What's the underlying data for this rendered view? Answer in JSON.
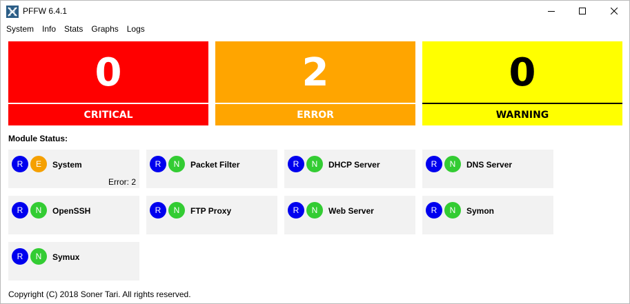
{
  "window": {
    "title": "PFFW 6.4.1"
  },
  "menu": [
    "System",
    "Info",
    "Stats",
    "Graphs",
    "Logs"
  ],
  "summary": {
    "critical": {
      "count": "0",
      "label": "CRITICAL",
      "color": "#ff0000"
    },
    "error": {
      "count": "2",
      "label": "ERROR",
      "color": "#ffa500"
    },
    "warning": {
      "count": "0",
      "label": "WARNING",
      "color": "#ffff00"
    }
  },
  "section_label": "Module Status:",
  "modules": [
    {
      "name": "System",
      "running": "R",
      "status": "E",
      "error_text": "Error: 2"
    },
    {
      "name": "Packet Filter",
      "running": "R",
      "status": "N"
    },
    {
      "name": "DHCP Server",
      "running": "R",
      "status": "N"
    },
    {
      "name": "DNS Server",
      "running": "R",
      "status": "N"
    },
    {
      "name": "OpenSSH",
      "running": "R",
      "status": "N"
    },
    {
      "name": "FTP Proxy",
      "running": "R",
      "status": "N"
    },
    {
      "name": "Web Server",
      "running": "R",
      "status": "N"
    },
    {
      "name": "Symon",
      "running": "R",
      "status": "N"
    },
    {
      "name": "Symux",
      "running": "R",
      "status": "N"
    }
  ],
  "badge_colors": {
    "running": "#0000ee",
    "normal": "#33cc33",
    "error": "#f5a000"
  },
  "footer": "Copyright (C) 2018 Soner Tari. All rights reserved."
}
